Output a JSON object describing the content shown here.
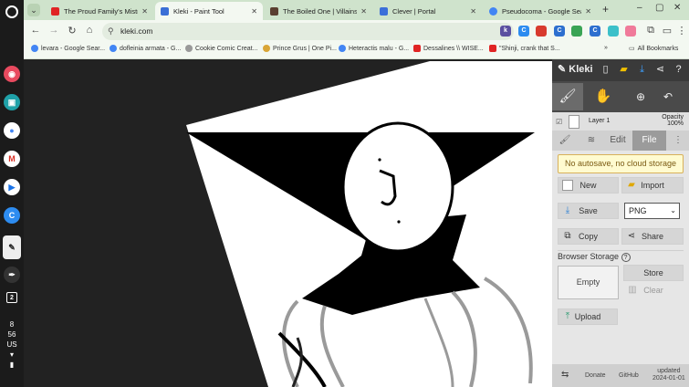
{
  "browser": {
    "tabs": [
      {
        "title": "The Proud Family's Mistreat...",
        "favicon_color": "#e02424"
      },
      {
        "title": "Kleki - Paint Tool",
        "favicon_color": "#3b6fd6",
        "active": true
      },
      {
        "title": "The Boiled One | Villains W...",
        "favicon_color": "#5a3f30"
      },
      {
        "title": "Clever | Portal",
        "favicon_color": "#3c6fd9"
      },
      {
        "title": "Pseudocoma - Google Sear...",
        "favicon_color": "#4285f4"
      }
    ],
    "url": "kleki.com",
    "bookmarks": [
      {
        "label": "levara - Google Sear...",
        "color": "#4285f4"
      },
      {
        "label": "dofleinia armata - G...",
        "color": "#4285f4"
      },
      {
        "label": "Cookie Comic Creat...",
        "color": "#999999"
      },
      {
        "label": "Prince Grus | One Pi...",
        "color": "#d9a536"
      },
      {
        "label": "Heteractis malu - G...",
        "color": "#4285f4"
      },
      {
        "label": "Dessalines \\\\ WISE...",
        "color": "#e02424"
      },
      {
        "label": "\"Shinji, crank that S...",
        "color": "#e02424"
      }
    ],
    "all_bookmarks": "All Bookmarks",
    "extensions": [
      {
        "label": "k",
        "color": "#5b4fa0"
      },
      {
        "label": "C",
        "color": "#2d8cf0"
      },
      {
        "label": "",
        "color": "#d83a2e"
      },
      {
        "label": "C",
        "color": "#2d6fcf"
      },
      {
        "label": "",
        "color": "#3aa455"
      },
      {
        "label": "C",
        "color": "#2d6fcf"
      },
      {
        "label": "",
        "color": "#3cc0c9"
      },
      {
        "label": "",
        "color": "#f07a9a"
      }
    ]
  },
  "shelf": {
    "status_date": "8",
    "status_time": "56",
    "status_locale": "US"
  },
  "kleki": {
    "logo": "Kleki",
    "layer_name": "Layer 1",
    "opacity_label": "Opacity",
    "opacity_value": "100%",
    "tabs": [
      "Edit",
      "File"
    ],
    "notice": "No autosave, no cloud storage",
    "new_label": "New",
    "import_label": "Import",
    "save_label": "Save",
    "format_value": "PNG",
    "copy_label": "Copy",
    "share_label": "Share",
    "browser_storage_label": "Browser Storage",
    "storage_empty": "Empty",
    "store_label": "Store",
    "clear_label": "Clear",
    "upload_label": "Upload",
    "footer": {
      "donate": "Donate",
      "github": "GitHub",
      "updated_label": "updated",
      "updated_date": "2024-01-01"
    }
  }
}
